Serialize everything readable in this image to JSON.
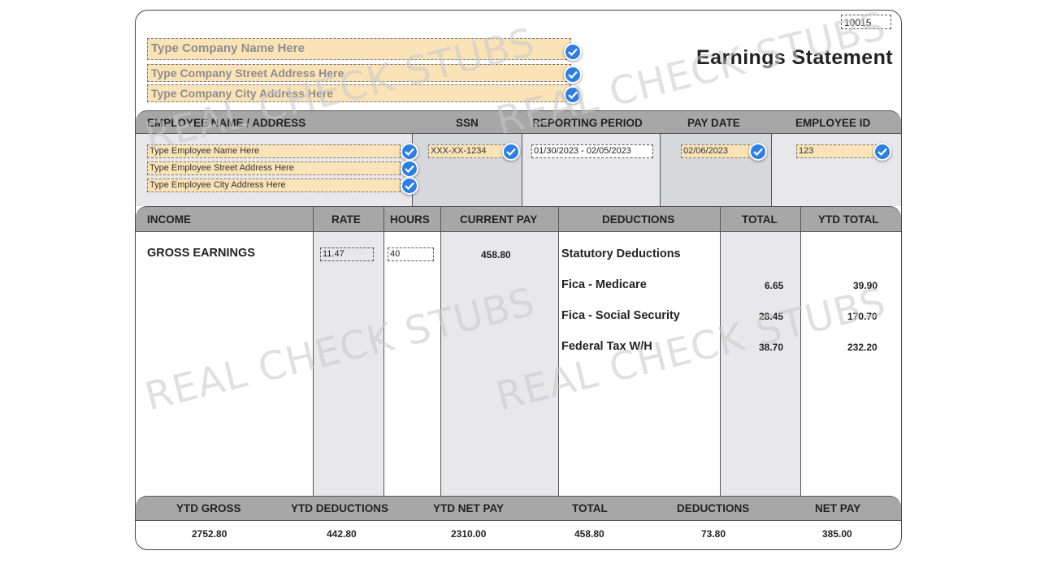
{
  "header": {
    "check_number": "10015",
    "title": "Earnings Statement",
    "company_name_placeholder": "Type Company Name Here",
    "company_street_placeholder": "Type Company Street Address Here",
    "company_city_placeholder": "Type Company City Address Here"
  },
  "employee_section": {
    "headers": {
      "name_address": "EMPLOYEE NAME / ADDRESS",
      "ssn": "SSN",
      "reporting_period": "REPORTING PERIOD",
      "pay_date": "PAY DATE",
      "employee_id": "EMPLOYEE ID"
    },
    "name_placeholder": "Type Employee Name Here",
    "street_placeholder": "Type Employee Street Address Here",
    "city_placeholder": "Type Employee City Address Here",
    "ssn": "XXX-XX-1234",
    "reporting_period": "01/30/2023 - 02/05/2023",
    "pay_date": "02/06/2023",
    "employee_id": "123"
  },
  "earnings_section": {
    "headers": {
      "income": "INCOME",
      "rate": "RATE",
      "hours": "HOURS",
      "current_pay": "CURRENT PAY",
      "deductions": "DEDUCTIONS",
      "total": "TOTAL",
      "ytd_total": "YTD TOTAL"
    },
    "income_label": "GROSS EARNINGS",
    "rate": "11.47",
    "hours": "40",
    "current_pay": "458.80",
    "deductions_title": "Statutory Deductions",
    "deductions": [
      {
        "name": "Fica - Medicare",
        "total": "6.65",
        "ytd": "39.90"
      },
      {
        "name": "Fica - Social Security",
        "total": "28.45",
        "ytd": "170.70"
      },
      {
        "name": "Federal Tax W/H",
        "total": "38.70",
        "ytd": "232.20"
      }
    ]
  },
  "summary": {
    "headers": {
      "ytd_gross": "YTD GROSS",
      "ytd_deductions": "YTD DEDUCTIONS",
      "ytd_net_pay": "YTD NET PAY",
      "total": "TOTAL",
      "deductions": "DEDUCTIONS",
      "net_pay": "NET PAY"
    },
    "values": {
      "ytd_gross": "2752.80",
      "ytd_deductions": "442.80",
      "ytd_net_pay": "2310.00",
      "total": "458.80",
      "deductions": "73.80",
      "net_pay": "385.00"
    }
  },
  "watermark": "REAL CHECK STUBS",
  "icons": {
    "confirm": "check-circle-icon"
  },
  "colors": {
    "field_bg": "#fbe3b8",
    "check_blue": "#2f7fe0",
    "band_gray": "#a7a7a7",
    "column_gray": "#e8e8eb"
  }
}
